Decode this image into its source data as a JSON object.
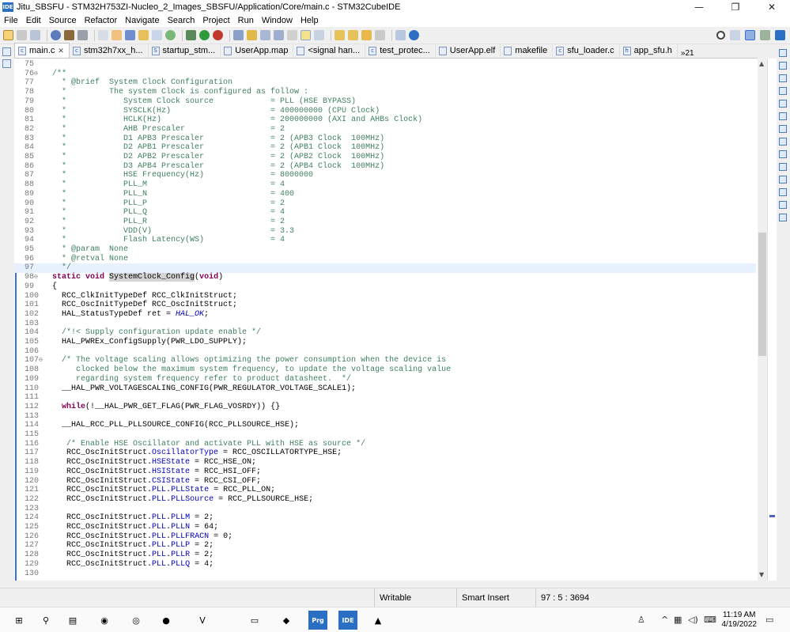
{
  "window": {
    "title": "Jitu_SBSFU - STM32H753ZI-Nucleo_2_Images_SBSFU/Application/Core/main.c - STM32CubeIDE",
    "app_icon_text": "IDE",
    "buttons": {
      "minimize": "—",
      "restore": "❐",
      "close": "✕"
    }
  },
  "menu": [
    "File",
    "Edit",
    "Source",
    "Refactor",
    "Navigate",
    "Search",
    "Project",
    "Run",
    "Window",
    "Help"
  ],
  "tabs": [
    {
      "label": "main.c",
      "active": true,
      "icon": "c-file-icon"
    },
    {
      "label": "stm32h7xx_h...",
      "active": false,
      "icon": "c-file-icon"
    },
    {
      "label": "startup_stm...",
      "active": false,
      "icon": "asm-file-icon"
    },
    {
      "label": "UserApp.map",
      "active": false,
      "icon": "map-file-icon"
    },
    {
      "label": "<signal han...",
      "active": false,
      "icon": "debug-icon"
    },
    {
      "label": "test_protec...",
      "active": false,
      "icon": "c-file-icon"
    },
    {
      "label": "UserApp.elf",
      "active": false,
      "icon": "elf-file-icon"
    },
    {
      "label": "makefile",
      "active": false,
      "icon": "make-file-icon"
    },
    {
      "label": "sfu_loader.c",
      "active": false,
      "icon": "c-file-icon"
    },
    {
      "label": "app_sfu.h",
      "active": false,
      "icon": "h-file-icon"
    }
  ],
  "tab_overflow": "»21",
  "code": [
    {
      "n": "75",
      "segs": [
        {
          "t": "",
          "c": ""
        }
      ]
    },
    {
      "n": "76",
      "fold": true,
      "segs": [
        {
          "t": "/**",
          "c": "cmt"
        }
      ]
    },
    {
      "n": "77",
      "segs": [
        {
          "t": "  * @brief  System Clock Configuration",
          "c": "cmt"
        }
      ]
    },
    {
      "n": "78",
      "segs": [
        {
          "t": "  *         The system Clock is configured as follow :",
          "c": "cmt"
        }
      ]
    },
    {
      "n": "79",
      "segs": [
        {
          "t": "  *            System Clock source            = PLL (HSE BYPASS)",
          "c": "cmt"
        }
      ]
    },
    {
      "n": "80",
      "segs": [
        {
          "t": "  *            SYSCLK(Hz)                     = 400000000 (CPU Clock)",
          "c": "cmt"
        }
      ]
    },
    {
      "n": "81",
      "segs": [
        {
          "t": "  *            HCLK(Hz)                       = 200000000 (AXI and AHBs Clock)",
          "c": "cmt"
        }
      ]
    },
    {
      "n": "82",
      "segs": [
        {
          "t": "  *            AHB Prescaler                  = 2",
          "c": "cmt"
        }
      ]
    },
    {
      "n": "83",
      "segs": [
        {
          "t": "  *            D1 APB3 Prescaler              = 2 (APB3 Clock  100MHz)",
          "c": "cmt"
        }
      ]
    },
    {
      "n": "84",
      "segs": [
        {
          "t": "  *            D2 APB1 Prescaler              = 2 (APB1 Clock  100MHz)",
          "c": "cmt"
        }
      ]
    },
    {
      "n": "85",
      "segs": [
        {
          "t": "  *            D2 APB2 Prescaler              = 2 (APB2 Clock  100MHz)",
          "c": "cmt"
        }
      ]
    },
    {
      "n": "86",
      "segs": [
        {
          "t": "  *            D3 APB4 Prescaler              = 2 (APB4 Clock  100MHz)",
          "c": "cmt"
        }
      ]
    },
    {
      "n": "87",
      "segs": [
        {
          "t": "  *            HSE Frequency(Hz)              = 8000000",
          "c": "cmt"
        }
      ]
    },
    {
      "n": "88",
      "segs": [
        {
          "t": "  *            PLL_M                          = 4",
          "c": "cmt"
        }
      ]
    },
    {
      "n": "89",
      "segs": [
        {
          "t": "  *            PLL_N                          = 400",
          "c": "cmt"
        }
      ]
    },
    {
      "n": "90",
      "segs": [
        {
          "t": "  *            PLL_P                          = 2",
          "c": "cmt"
        }
      ]
    },
    {
      "n": "91",
      "segs": [
        {
          "t": "  *            PLL_Q                          = 4",
          "c": "cmt"
        }
      ]
    },
    {
      "n": "92",
      "segs": [
        {
          "t": "  *            PLL_R                          = 2",
          "c": "cmt"
        }
      ]
    },
    {
      "n": "93",
      "segs": [
        {
          "t": "  *            VDD(V)                         = 3.3",
          "c": "cmt"
        }
      ]
    },
    {
      "n": "94",
      "segs": [
        {
          "t": "  *            Flash Latency(WS)              = 4",
          "c": "cmt"
        }
      ]
    },
    {
      "n": "95",
      "segs": [
        {
          "t": "  * @param  None",
          "c": "cmt"
        }
      ]
    },
    {
      "n": "96",
      "segs": [
        {
          "t": "  * @retval None",
          "c": "cmt"
        }
      ]
    },
    {
      "n": "97",
      "current": true,
      "segs": [
        {
          "t": "  */",
          "c": "cmt"
        }
      ]
    },
    {
      "n": "98",
      "fold": true,
      "segs": [
        {
          "t": "static void ",
          "c": "kw"
        },
        {
          "t": "SystemClock_Config",
          "c": "hlname"
        },
        {
          "t": "(",
          "c": ""
        },
        {
          "t": "void",
          "c": "kw"
        },
        {
          "t": ")",
          "c": ""
        }
      ]
    },
    {
      "n": "99",
      "segs": [
        {
          "t": "{",
          "c": ""
        }
      ]
    },
    {
      "n": "100",
      "segs": [
        {
          "t": "  RCC_ClkInitTypeDef RCC_ClkInitStruct;",
          "c": ""
        }
      ]
    },
    {
      "n": "101",
      "segs": [
        {
          "t": "  RCC_OscInitTypeDef RCC_OscInitStruct;",
          "c": ""
        }
      ]
    },
    {
      "n": "102",
      "segs": [
        {
          "t": "  HAL_StatusTypeDef ret = ",
          "c": ""
        },
        {
          "t": "HAL_OK",
          "c": "ital"
        },
        {
          "t": ";",
          "c": ""
        }
      ]
    },
    {
      "n": "103",
      "segs": [
        {
          "t": "",
          "c": ""
        }
      ]
    },
    {
      "n": "104",
      "segs": [
        {
          "t": "  /*!< Supply configuration update enable */",
          "c": "cmt"
        }
      ]
    },
    {
      "n": "105",
      "segs": [
        {
          "t": "  HAL_PWREx_ConfigSupply(PWR_LDO_SUPPLY);",
          "c": ""
        }
      ]
    },
    {
      "n": "106",
      "segs": [
        {
          "t": "",
          "c": ""
        }
      ]
    },
    {
      "n": "107",
      "fold": true,
      "segs": [
        {
          "t": "  /* The voltage scaling allows optimizing the power consumption when the device is",
          "c": "cmt"
        }
      ]
    },
    {
      "n": "108",
      "segs": [
        {
          "t": "     clocked below the maximum system frequency, to update the voltage scaling value",
          "c": "cmt"
        }
      ]
    },
    {
      "n": "109",
      "segs": [
        {
          "t": "     regarding system frequency refer to product datasheet.  */",
          "c": "cmt"
        }
      ]
    },
    {
      "n": "110",
      "segs": [
        {
          "t": "  __HAL_PWR_VOLTAGESCALING_CONFIG(PWR_REGULATOR_VOLTAGE_SCALE1);",
          "c": ""
        }
      ]
    },
    {
      "n": "111",
      "segs": [
        {
          "t": "",
          "c": ""
        }
      ]
    },
    {
      "n": "112",
      "segs": [
        {
          "t": "  ",
          "c": ""
        },
        {
          "t": "while",
          "c": "kw"
        },
        {
          "t": "(!__HAL_PWR_GET_FLAG(PWR_FLAG_VOSRDY)) {}",
          "c": ""
        }
      ]
    },
    {
      "n": "113",
      "segs": [
        {
          "t": "",
          "c": ""
        }
      ]
    },
    {
      "n": "114",
      "segs": [
        {
          "t": "  __HAL_RCC_PLL_PLLSOURCE_CONFIG(RCC_PLLSOURCE_HSE);",
          "c": ""
        }
      ]
    },
    {
      "n": "115",
      "segs": [
        {
          "t": "",
          "c": ""
        }
      ]
    },
    {
      "n": "116",
      "segs": [
        {
          "t": "   /* Enable HSE Oscillator and activate PLL with HSE as source */",
          "c": "cmt"
        }
      ]
    },
    {
      "n": "117",
      "segs": [
        {
          "t": "   RCC_OscInitStruct.",
          "c": ""
        },
        {
          "t": "OscillatorType",
          "c": "fld"
        },
        {
          "t": " = RCC_OSCILLATORTYPE_HSE;",
          "c": ""
        }
      ]
    },
    {
      "n": "118",
      "segs": [
        {
          "t": "   RCC_OscInitStruct.",
          "c": ""
        },
        {
          "t": "HSEState",
          "c": "fld"
        },
        {
          "t": " = RCC_HSE_ON;",
          "c": ""
        }
      ]
    },
    {
      "n": "119",
      "segs": [
        {
          "t": "   RCC_OscInitStruct.",
          "c": ""
        },
        {
          "t": "HSIState",
          "c": "fld"
        },
        {
          "t": " = RCC_HSI_OFF;",
          "c": ""
        }
      ]
    },
    {
      "n": "120",
      "segs": [
        {
          "t": "   RCC_OscInitStruct.",
          "c": ""
        },
        {
          "t": "CSIState",
          "c": "fld"
        },
        {
          "t": " = RCC_CSI_OFF;",
          "c": ""
        }
      ]
    },
    {
      "n": "121",
      "segs": [
        {
          "t": "   RCC_OscInitStruct.",
          "c": ""
        },
        {
          "t": "PLL",
          "c": "fld"
        },
        {
          "t": ".",
          "c": ""
        },
        {
          "t": "PLLState",
          "c": "fld"
        },
        {
          "t": " = RCC_PLL_ON;",
          "c": ""
        }
      ]
    },
    {
      "n": "122",
      "segs": [
        {
          "t": "   RCC_OscInitStruct.",
          "c": ""
        },
        {
          "t": "PLL",
          "c": "fld"
        },
        {
          "t": ".",
          "c": ""
        },
        {
          "t": "PLLSource",
          "c": "fld"
        },
        {
          "t": " = RCC_PLLSOURCE_HSE;",
          "c": ""
        }
      ]
    },
    {
      "n": "123",
      "segs": [
        {
          "t": "",
          "c": ""
        }
      ]
    },
    {
      "n": "124",
      "segs": [
        {
          "t": "   RCC_OscInitStruct.",
          "c": ""
        },
        {
          "t": "PLL",
          "c": "fld"
        },
        {
          "t": ".",
          "c": ""
        },
        {
          "t": "PLLM",
          "c": "fld"
        },
        {
          "t": " = 2;",
          "c": ""
        }
      ]
    },
    {
      "n": "125",
      "segs": [
        {
          "t": "   RCC_OscInitStruct.",
          "c": ""
        },
        {
          "t": "PLL",
          "c": "fld"
        },
        {
          "t": ".",
          "c": ""
        },
        {
          "t": "PLLN",
          "c": "fld"
        },
        {
          "t": " = 64;",
          "c": ""
        }
      ]
    },
    {
      "n": "126",
      "segs": [
        {
          "t": "   RCC_OscInitStruct.",
          "c": ""
        },
        {
          "t": "PLL",
          "c": "fld"
        },
        {
          "t": ".",
          "c": ""
        },
        {
          "t": "PLLFRACN",
          "c": "fld"
        },
        {
          "t": " = 0;",
          "c": ""
        }
      ]
    },
    {
      "n": "127",
      "segs": [
        {
          "t": "   RCC_OscInitStruct.",
          "c": ""
        },
        {
          "t": "PLL",
          "c": "fld"
        },
        {
          "t": ".",
          "c": ""
        },
        {
          "t": "PLLP",
          "c": "fld"
        },
        {
          "t": " = 2;",
          "c": ""
        }
      ]
    },
    {
      "n": "128",
      "segs": [
        {
          "t": "   RCC_OscInitStruct.",
          "c": ""
        },
        {
          "t": "PLL",
          "c": "fld"
        },
        {
          "t": ".",
          "c": ""
        },
        {
          "t": "PLLR",
          "c": "fld"
        },
        {
          "t": " = 2;",
          "c": ""
        }
      ]
    },
    {
      "n": "129",
      "segs": [
        {
          "t": "   RCC_OscInitStruct.",
          "c": ""
        },
        {
          "t": "PLL",
          "c": "fld"
        },
        {
          "t": ".",
          "c": ""
        },
        {
          "t": "PLLQ",
          "c": "fld"
        },
        {
          "t": " = 4;",
          "c": ""
        }
      ]
    },
    {
      "n": "130",
      "segs": [
        {
          "t": "",
          "c": ""
        }
      ]
    }
  ],
  "status": {
    "writable": "Writable",
    "insert_mode": "Smart Insert",
    "position": "97 : 5 : 3694"
  },
  "taskbar": {
    "time": "11:19 AM",
    "date": "4/19/2022",
    "apps": [
      {
        "name": "windows-start-icon",
        "glyph": "⊞"
      },
      {
        "name": "search-icon",
        "glyph": "⚲"
      },
      {
        "name": "task-view-icon",
        "glyph": "▤"
      },
      {
        "name": "app-icon-1",
        "glyph": "◉"
      },
      {
        "name": "app-icon-2",
        "glyph": "◎"
      },
      {
        "name": "chrome-icon",
        "glyph": "●"
      },
      {
        "name": "vscode-icon",
        "glyph": "V"
      },
      {
        "name": "file-explorer-icon",
        "glyph": "▭"
      },
      {
        "name": "app-icon-3",
        "glyph": "◆"
      },
      {
        "name": "stm32-programmer-icon",
        "glyph": "Prg"
      },
      {
        "name": "stm32cubeide-icon",
        "glyph": "IDE"
      },
      {
        "name": "app-icon-4",
        "glyph": "▲"
      }
    ]
  },
  "colors": {
    "comment": "#3f7f5f",
    "keyword": "#7f0055",
    "field": "#0000c0",
    "current_line": "#e8f2fe",
    "taskbar_active": "#2b6fc5"
  }
}
